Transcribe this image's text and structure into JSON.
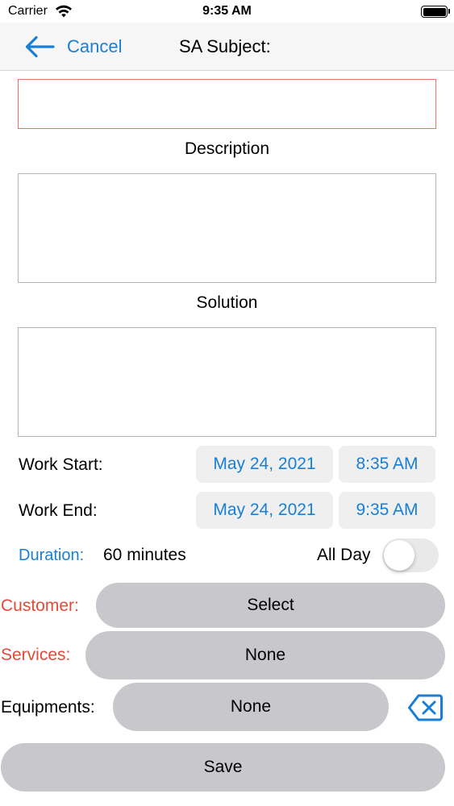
{
  "status_bar": {
    "carrier": "Carrier",
    "time": "9:35 AM"
  },
  "nav": {
    "back_label": "Cancel",
    "title": "SA Subject:"
  },
  "form": {
    "subject_value": "",
    "description_label": "Description",
    "description_value": "",
    "solution_label": "Solution",
    "solution_value": "",
    "work_start": {
      "label": "Work Start:",
      "date": "May 24, 2021",
      "time": "8:35 AM"
    },
    "work_end": {
      "label": "Work End:",
      "date": "May 24, 2021",
      "time": "9:35 AM"
    },
    "duration": {
      "label": "Duration:",
      "value": "60 minutes"
    },
    "all_day": {
      "label": "All Day",
      "on": false
    },
    "customer": {
      "label": "Customer:",
      "value": "Select"
    },
    "services": {
      "label": "Services:",
      "value": "None"
    },
    "equipments": {
      "label": "Equipments:",
      "value": "None"
    },
    "save_label": "Save"
  },
  "colors": {
    "accent": "#1a7fd4",
    "required": "#e24a39",
    "button_gray": "#c7c7cc"
  },
  "icons": [
    "wifi-icon",
    "battery-icon",
    "back-arrow-icon",
    "clear-icon"
  ]
}
